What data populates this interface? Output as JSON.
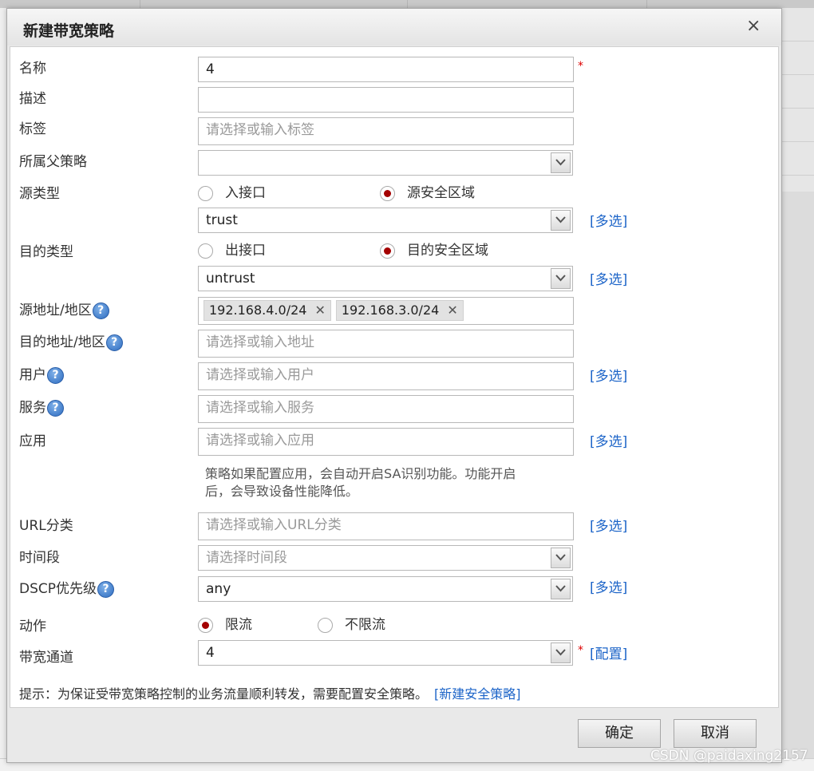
{
  "dialog": {
    "title": "新建带宽策略",
    "close": "×"
  },
  "form": {
    "name": {
      "label": "名称",
      "value": "4",
      "required": "*"
    },
    "description": {
      "label": "描述",
      "value": ""
    },
    "tags": {
      "label": "标签",
      "placeholder": "请选择或输入标签"
    },
    "parent_policy": {
      "label": "所属父策略",
      "value": ""
    },
    "source_type": {
      "label": "源类型",
      "option_interface": "入接口",
      "option_zone": "源安全区域",
      "selected": "源安全区域",
      "zone_value": "trust",
      "multi": "[多选]"
    },
    "dest_type": {
      "label": "目的类型",
      "option_interface": "出接口",
      "option_zone": "目的安全区域",
      "selected": "目的安全区域",
      "zone_value": "untrust",
      "multi": "[多选]"
    },
    "source_address": {
      "label": "源地址/地区",
      "help": "?",
      "tags": [
        "192.168.4.0/24",
        "192.168.3.0/24"
      ]
    },
    "dest_address": {
      "label": "目的地址/地区",
      "help": "?",
      "placeholder": "请选择或输入地址"
    },
    "user": {
      "label": "用户",
      "help": "?",
      "placeholder": "请选择或输入用户",
      "multi": "[多选]"
    },
    "service": {
      "label": "服务",
      "help": "?",
      "placeholder": "请选择或输入服务"
    },
    "application": {
      "label": "应用",
      "placeholder": "请选择或输入应用",
      "multi": "[多选]",
      "hint_line1": "策略如果配置应用，会自动开启SA识别功能。功能开启",
      "hint_line2": "后，会导致设备性能降低。"
    },
    "url_category": {
      "label": "URL分类",
      "placeholder": "请选择或输入URL分类",
      "multi": "[多选]"
    },
    "time_range": {
      "label": "时间段",
      "placeholder": "请选择时间段"
    },
    "dscp": {
      "label": "DSCP优先级",
      "help": "?",
      "value": "any",
      "multi": "[多选]"
    },
    "action": {
      "label": "动作",
      "option_limit": "限流",
      "option_nolimit": "不限流",
      "selected": "限流"
    },
    "bandwidth_channel": {
      "label": "带宽通道",
      "value": "4",
      "required": "*",
      "config": "[配置]"
    },
    "tip": {
      "text": "提示：为保证受带宽策略控制的业务流量顺利转发，需要配置安全策略。",
      "link": "[新建安全策略]"
    }
  },
  "buttons": {
    "ok": "确定",
    "cancel": "取消"
  },
  "watermark": "CSDN @paidaxing2157",
  "colors": {
    "link": "#1c64c8",
    "required": "#dd0000",
    "radio_selected": "#a40000"
  }
}
